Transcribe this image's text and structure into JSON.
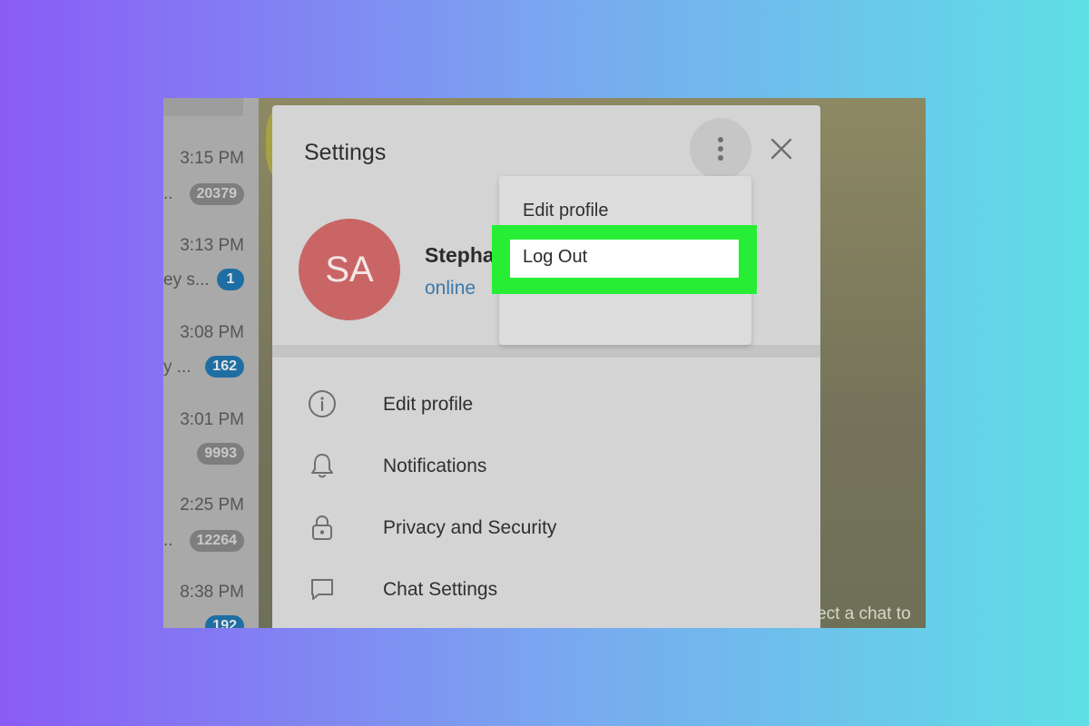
{
  "chat_list": {
    "items": [
      {
        "time": "3:15 PM",
        "snippet": "..",
        "badge": "20379",
        "badge_style": "muted"
      },
      {
        "time": "3:13 PM",
        "snippet": "ey s...",
        "badge": "1",
        "badge_style": "unmuted"
      },
      {
        "time": "3:08 PM",
        "snippet": "y ...",
        "badge": "162",
        "badge_style": "unmuted"
      },
      {
        "time": "3:01 PM",
        "snippet": "",
        "badge": "9993",
        "badge_style": "muted"
      },
      {
        "time": "2:25 PM",
        "snippet": "..",
        "badge": "12264",
        "badge_style": "muted"
      },
      {
        "time": "8:38 PM",
        "snippet": "",
        "badge": "192",
        "badge_style": "unmuted"
      }
    ]
  },
  "chat_area": {
    "placeholder": "ect a chat to"
  },
  "settings": {
    "title": "Settings",
    "more_icon": "vertical-dots-icon",
    "close_icon": "close-icon",
    "profile": {
      "initials": "SA",
      "name": "Stepha",
      "status": "online",
      "avatar_color": "#c96565"
    },
    "menu": [
      {
        "icon": "info-icon",
        "label": "Edit profile"
      },
      {
        "icon": "bell-icon",
        "label": "Notifications"
      },
      {
        "icon": "lock-icon",
        "label": "Privacy and Security"
      },
      {
        "icon": "chat-bubble-icon",
        "label": "Chat Settings"
      }
    ]
  },
  "dropdown": {
    "edit_profile": "Edit profile",
    "log_out": "Log Out",
    "highlight_color": "#27ee34"
  }
}
